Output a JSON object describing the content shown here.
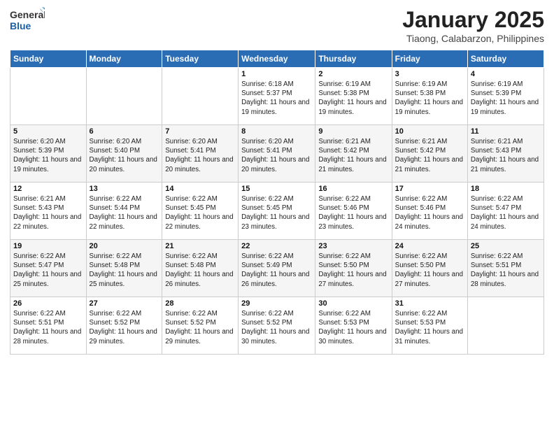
{
  "logo": {
    "general": "General",
    "blue": "Blue"
  },
  "title": "January 2025",
  "subtitle": "Tiaong, Calabarzon, Philippines",
  "days": [
    "Sunday",
    "Monday",
    "Tuesday",
    "Wednesday",
    "Thursday",
    "Friday",
    "Saturday"
  ],
  "weeks": [
    [
      {
        "day": "",
        "info": ""
      },
      {
        "day": "",
        "info": ""
      },
      {
        "day": "",
        "info": ""
      },
      {
        "day": "1",
        "info": "Sunrise: 6:18 AM\nSunset: 5:37 PM\nDaylight: 11 hours and 19 minutes."
      },
      {
        "day": "2",
        "info": "Sunrise: 6:19 AM\nSunset: 5:38 PM\nDaylight: 11 hours and 19 minutes."
      },
      {
        "day": "3",
        "info": "Sunrise: 6:19 AM\nSunset: 5:38 PM\nDaylight: 11 hours and 19 minutes."
      },
      {
        "day": "4",
        "info": "Sunrise: 6:19 AM\nSunset: 5:39 PM\nDaylight: 11 hours and 19 minutes."
      }
    ],
    [
      {
        "day": "5",
        "info": "Sunrise: 6:20 AM\nSunset: 5:39 PM\nDaylight: 11 hours and 19 minutes."
      },
      {
        "day": "6",
        "info": "Sunrise: 6:20 AM\nSunset: 5:40 PM\nDaylight: 11 hours and 20 minutes."
      },
      {
        "day": "7",
        "info": "Sunrise: 6:20 AM\nSunset: 5:41 PM\nDaylight: 11 hours and 20 minutes."
      },
      {
        "day": "8",
        "info": "Sunrise: 6:20 AM\nSunset: 5:41 PM\nDaylight: 11 hours and 20 minutes."
      },
      {
        "day": "9",
        "info": "Sunrise: 6:21 AM\nSunset: 5:42 PM\nDaylight: 11 hours and 21 minutes."
      },
      {
        "day": "10",
        "info": "Sunrise: 6:21 AM\nSunset: 5:42 PM\nDaylight: 11 hours and 21 minutes."
      },
      {
        "day": "11",
        "info": "Sunrise: 6:21 AM\nSunset: 5:43 PM\nDaylight: 11 hours and 21 minutes."
      }
    ],
    [
      {
        "day": "12",
        "info": "Sunrise: 6:21 AM\nSunset: 5:43 PM\nDaylight: 11 hours and 22 minutes."
      },
      {
        "day": "13",
        "info": "Sunrise: 6:22 AM\nSunset: 5:44 PM\nDaylight: 11 hours and 22 minutes."
      },
      {
        "day": "14",
        "info": "Sunrise: 6:22 AM\nSunset: 5:45 PM\nDaylight: 11 hours and 22 minutes."
      },
      {
        "day": "15",
        "info": "Sunrise: 6:22 AM\nSunset: 5:45 PM\nDaylight: 11 hours and 23 minutes."
      },
      {
        "day": "16",
        "info": "Sunrise: 6:22 AM\nSunset: 5:46 PM\nDaylight: 11 hours and 23 minutes."
      },
      {
        "day": "17",
        "info": "Sunrise: 6:22 AM\nSunset: 5:46 PM\nDaylight: 11 hours and 24 minutes."
      },
      {
        "day": "18",
        "info": "Sunrise: 6:22 AM\nSunset: 5:47 PM\nDaylight: 11 hours and 24 minutes."
      }
    ],
    [
      {
        "day": "19",
        "info": "Sunrise: 6:22 AM\nSunset: 5:47 PM\nDaylight: 11 hours and 25 minutes."
      },
      {
        "day": "20",
        "info": "Sunrise: 6:22 AM\nSunset: 5:48 PM\nDaylight: 11 hours and 25 minutes."
      },
      {
        "day": "21",
        "info": "Sunrise: 6:22 AM\nSunset: 5:48 PM\nDaylight: 11 hours and 26 minutes."
      },
      {
        "day": "22",
        "info": "Sunrise: 6:22 AM\nSunset: 5:49 PM\nDaylight: 11 hours and 26 minutes."
      },
      {
        "day": "23",
        "info": "Sunrise: 6:22 AM\nSunset: 5:50 PM\nDaylight: 11 hours and 27 minutes."
      },
      {
        "day": "24",
        "info": "Sunrise: 6:22 AM\nSunset: 5:50 PM\nDaylight: 11 hours and 27 minutes."
      },
      {
        "day": "25",
        "info": "Sunrise: 6:22 AM\nSunset: 5:51 PM\nDaylight: 11 hours and 28 minutes."
      }
    ],
    [
      {
        "day": "26",
        "info": "Sunrise: 6:22 AM\nSunset: 5:51 PM\nDaylight: 11 hours and 28 minutes."
      },
      {
        "day": "27",
        "info": "Sunrise: 6:22 AM\nSunset: 5:52 PM\nDaylight: 11 hours and 29 minutes."
      },
      {
        "day": "28",
        "info": "Sunrise: 6:22 AM\nSunset: 5:52 PM\nDaylight: 11 hours and 29 minutes."
      },
      {
        "day": "29",
        "info": "Sunrise: 6:22 AM\nSunset: 5:52 PM\nDaylight: 11 hours and 30 minutes."
      },
      {
        "day": "30",
        "info": "Sunrise: 6:22 AM\nSunset: 5:53 PM\nDaylight: 11 hours and 30 minutes."
      },
      {
        "day": "31",
        "info": "Sunrise: 6:22 AM\nSunset: 5:53 PM\nDaylight: 11 hours and 31 minutes."
      },
      {
        "day": "",
        "info": ""
      }
    ]
  ]
}
